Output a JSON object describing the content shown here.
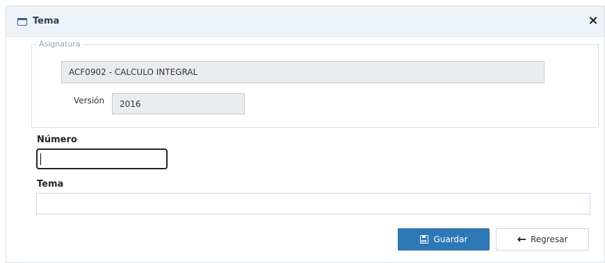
{
  "dialog": {
    "title": "Tema",
    "close_icon": "close-icon",
    "title_icon": "window-icon"
  },
  "asignatura": {
    "legend": "Asignatura",
    "subject_value": "ACF0902 - CALCULO INTEGRAL",
    "version_label": "Versión",
    "version_value": "2016"
  },
  "form": {
    "numero_label": "Número",
    "numero_value": "",
    "tema_label": "Tema",
    "tema_value": ""
  },
  "buttons": {
    "save_label": "Guardar",
    "save_icon": "floppy-disk-icon",
    "back_label": "Regresar",
    "back_icon": "arrow-left-icon"
  },
  "colors": {
    "primary": "#2f78b8",
    "titlebar_bg": "#eef3f9"
  }
}
